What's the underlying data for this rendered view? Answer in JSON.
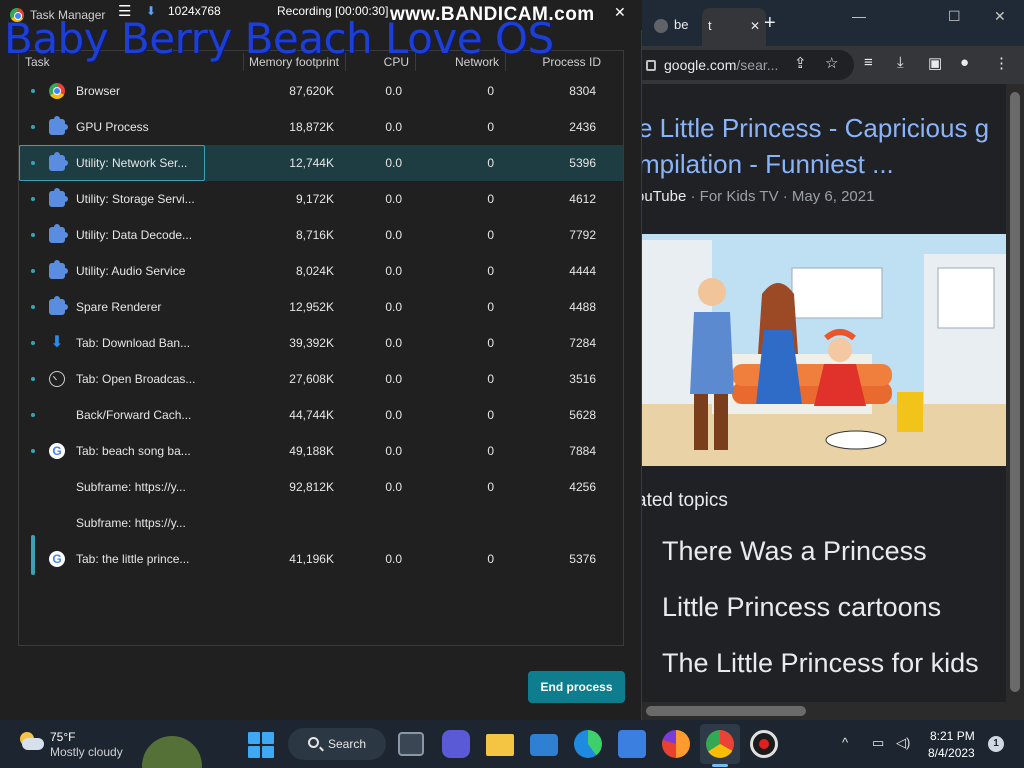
{
  "recording": {
    "resolution": "1024x768",
    "status": "Recording [00:00:30]",
    "brand": "www.BANDICAM.com",
    "watermark": "Baby Berry Beach Love OS"
  },
  "task_manager": {
    "title": "Task Manager",
    "columns": [
      "Task",
      "Memory footprint",
      "CPU",
      "Network",
      "Process ID"
    ],
    "rows": [
      {
        "task": "Browser",
        "memory": "87,620K",
        "cpu": "0.0",
        "network": "0",
        "pid": "8304",
        "icon": "chrome-icon"
      },
      {
        "task": "GPU Process",
        "memory": "18,872K",
        "cpu": "0.0",
        "network": "0",
        "pid": "2436",
        "icon": "extension-icon"
      },
      {
        "task": "Utility: Network Ser...",
        "memory": "12,744K",
        "cpu": "0.0",
        "network": "0",
        "pid": "5396",
        "icon": "extension-icon"
      },
      {
        "task": "Utility: Storage Servi...",
        "memory": "9,172K",
        "cpu": "0.0",
        "network": "0",
        "pid": "4612",
        "icon": "extension-icon"
      },
      {
        "task": "Utility: Data Decode...",
        "memory": "8,716K",
        "cpu": "0.0",
        "network": "0",
        "pid": "7792",
        "icon": "extension-icon"
      },
      {
        "task": "Utility: Audio Service",
        "memory": "8,024K",
        "cpu": "0.0",
        "network": "0",
        "pid": "4444",
        "icon": "extension-icon"
      },
      {
        "task": "Spare Renderer",
        "memory": "12,952K",
        "cpu": "0.0",
        "network": "0",
        "pid": "4488",
        "icon": "extension-icon"
      },
      {
        "task": "Tab: Download Ban...",
        "memory": "39,392K",
        "cpu": "0.0",
        "network": "0",
        "pid": "7284",
        "icon": "download-icon"
      },
      {
        "task": "Tab: Open Broadcas...",
        "memory": "27,608K",
        "cpu": "0.0",
        "network": "0",
        "pid": "3516",
        "icon": "clock-icon"
      },
      {
        "task": "Back/Forward Cach...",
        "memory": "44,744K",
        "cpu": "0.0",
        "network": "0",
        "pid": "5628",
        "icon": ""
      },
      {
        "task": "Tab: beach song ba...",
        "memory": "49,188K",
        "cpu": "0.0",
        "network": "0",
        "pid": "7884",
        "icon": "google-icon"
      },
      {
        "task": "Subframe: https://y...",
        "memory": "92,812K",
        "cpu": "0.0",
        "network": "0",
        "pid": "4256",
        "icon": ""
      },
      {
        "task": "Subframe: https://y...",
        "memory": "",
        "cpu": "",
        "network": "",
        "pid": "",
        "icon": ""
      },
      {
        "task": "Tab: the little prince...",
        "memory": "41,196K",
        "cpu": "0.0",
        "network": "0",
        "pid": "5376",
        "icon": "google-icon"
      }
    ],
    "end_process_label": "End process"
  },
  "browser": {
    "tabs": [
      {
        "label": "be"
      },
      {
        "label": "t"
      }
    ],
    "url_host": "google.com",
    "url_rest": "/sear...",
    "result_title_line1": "e Little Princess - Capricious g",
    "result_title_line2": "mpilation - Funniest ...",
    "result_source": "ouTube",
    "result_meta": " · For Kids TV · May 6, 2021",
    "related_heading": "ated topics",
    "related": [
      "There Was a Princess",
      "Little Princess cartoons",
      "The Little Princess for kids"
    ]
  },
  "taskbar": {
    "weather_temp": "75°F",
    "weather_desc": "Mostly cloudy",
    "search_label": "Search",
    "time": "8:21 PM",
    "date": "8/4/2023",
    "notification_count": "1"
  }
}
